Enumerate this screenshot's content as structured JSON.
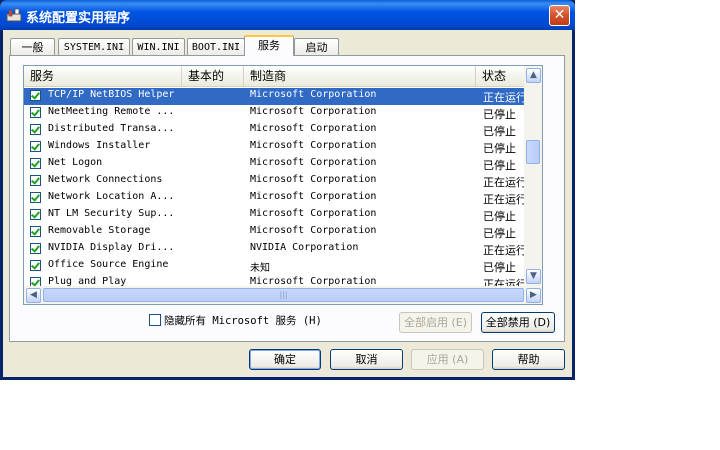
{
  "window": {
    "title": "系统配置实用程序",
    "close_label": "✕"
  },
  "tabs": [
    {
      "label": "一般"
    },
    {
      "label": "SYSTEM.INI"
    },
    {
      "label": "WIN.INI"
    },
    {
      "label": "BOOT.INI"
    },
    {
      "label": "服务"
    },
    {
      "label": "启动"
    }
  ],
  "active_tab": "服务",
  "services": {
    "columns": [
      "服务",
      "基本的",
      "制造商",
      "状态"
    ],
    "rows": [
      {
        "name": "TCP/IP NetBIOS Helper",
        "vendor": "Microsoft Corporation",
        "status": "正在运行",
        "checked": true,
        "selected": true
      },
      {
        "name": "NetMeeting Remote ...",
        "vendor": "Microsoft Corporation",
        "status": "已停止",
        "checked": true
      },
      {
        "name": "Distributed Transa...",
        "vendor": "Microsoft Corporation",
        "status": "已停止",
        "checked": true
      },
      {
        "name": "Windows Installer",
        "vendor": "Microsoft Corporation",
        "status": "已停止",
        "checked": true
      },
      {
        "name": "Net Logon",
        "vendor": "Microsoft Corporation",
        "status": "已停止",
        "checked": true
      },
      {
        "name": "Network Connections",
        "vendor": "Microsoft Corporation",
        "status": "正在运行",
        "checked": true
      },
      {
        "name": "Network Location A...",
        "vendor": "Microsoft Corporation",
        "status": "正在运行",
        "checked": true
      },
      {
        "name": "NT LM Security Sup...",
        "vendor": "Microsoft Corporation",
        "status": "已停止",
        "checked": true
      },
      {
        "name": "Removable Storage",
        "vendor": "Microsoft Corporation",
        "status": "已停止",
        "checked": true
      },
      {
        "name": "NVIDIA Display Dri...",
        "vendor": "NVIDIA Corporation",
        "status": "正在运行",
        "checked": true
      },
      {
        "name": "Office Source Engine",
        "vendor": "未知",
        "status": "已停止",
        "checked": true
      },
      {
        "name": "Plug and Play",
        "vendor": "Microsoft Corporation",
        "status": "正在运行",
        "checked": true
      }
    ]
  },
  "hide_ms_label": "隐藏所有 Microsoft 服务 (H)",
  "buttons": {
    "enable_all": "全部启用 (E)",
    "disable_all": "全部禁用 (D)",
    "ok": "确定",
    "cancel": "取消",
    "apply": "应用 (A)",
    "help": "帮助"
  },
  "icons": {
    "app": "msconfig-app-icon",
    "scroll_up": "▲",
    "scroll_down": "▼",
    "scroll_left": "◀",
    "scroll_right": "▶",
    "grip": "|||"
  }
}
